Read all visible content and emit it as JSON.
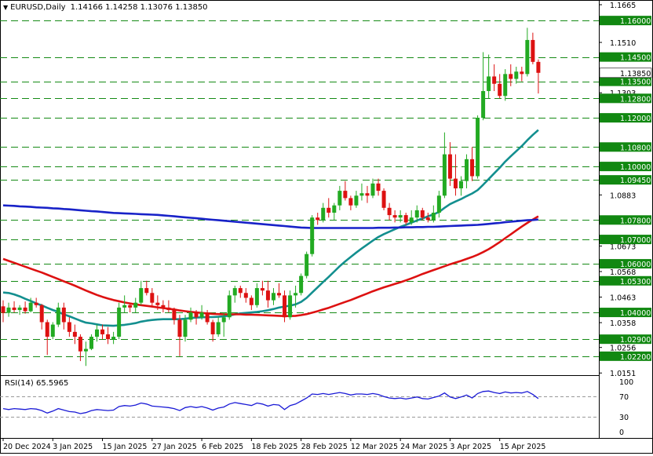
{
  "header": {
    "symbol": "EURUSD,Daily",
    "ohlc": "1.14166 1.14258 1.13076 1.13850"
  },
  "rsi_header": "RSI(14) 65.5965",
  "colors": {
    "up": "#22aa22",
    "down": "#dd1111",
    "ma_short": "#138f8f",
    "ma_mid": "#dd1111",
    "ma_long": "#1822c8",
    "level_line": "#158a15",
    "label_bg": "#118811",
    "rsi": "#1a1ad6",
    "rsi_level": "#999999"
  },
  "chart_data": [
    {
      "type": "candlestick",
      "title": "EURUSD,Daily",
      "ylim": [
        1.0155,
        1.1665
      ],
      "price_scale": [
        "1.1665",
        "1.1510",
        "1.1385",
        "1.1303",
        "1.0883",
        "1.0673",
        "1.0568",
        "1.0463",
        "1.0358",
        "1.0256",
        "1.0151"
      ],
      "levels": [
        {
          "value": 1.16,
          "label": "1.16000"
        },
        {
          "value": 1.145,
          "label": "1.14500"
        },
        {
          "value": 1.135,
          "label": "1.13500"
        },
        {
          "value": 1.128,
          "label": "1.12800"
        },
        {
          "value": 1.12,
          "label": "1.12000"
        },
        {
          "value": 1.108,
          "label": "1.10800"
        },
        {
          "value": 1.1,
          "label": "1.10000"
        },
        {
          "value": 1.0945,
          "label": "1.09450"
        },
        {
          "value": 1.078,
          "label": "1.07800"
        },
        {
          "value": 1.07,
          "label": "1.07000"
        },
        {
          "value": 1.06,
          "label": "1.06000"
        },
        {
          "value": 1.053,
          "label": "1.05300"
        },
        {
          "value": 1.04,
          "label": "1.04000"
        },
        {
          "value": 1.029,
          "label": "1.02900"
        },
        {
          "value": 1.022,
          "label": "1.02200"
        }
      ],
      "current_price": {
        "value": 1.1385,
        "label": "1.13850"
      },
      "x_labels": [
        "20 Dec 2024",
        "3 Jan 2025",
        "15 Jan 2025",
        "27 Jan 2025",
        "6 Feb 2025",
        "18 Feb 2025",
        "28 Feb 2025",
        "12 Mar 2025",
        "24 Mar 2025",
        "3 Apr 2025",
        "15 Apr 2025"
      ],
      "x_label_index": [
        0,
        9,
        18,
        27,
        36,
        45,
        54,
        63,
        72,
        81,
        90
      ],
      "candles": [
        [
          1.0425,
          1.045,
          1.036,
          1.0398
        ],
        [
          1.0398,
          1.044,
          1.0382,
          1.042
        ],
        [
          1.042,
          1.0446,
          1.04,
          1.041
        ],
        [
          1.041,
          1.043,
          1.039,
          1.042
        ],
        [
          1.042,
          1.0445,
          1.0395,
          1.0405
        ],
        [
          1.0405,
          1.046,
          1.04,
          1.044
        ],
        [
          1.044,
          1.046,
          1.042,
          1.043
        ],
        [
          1.043,
          1.0435,
          1.033,
          1.036
        ],
        [
          1.036,
          1.037,
          1.0225,
          1.03
        ],
        [
          1.03,
          1.036,
          1.029,
          1.035
        ],
        [
          1.035,
          1.044,
          1.034,
          1.042
        ],
        [
          1.042,
          1.044,
          1.033,
          1.036
        ],
        [
          1.036,
          1.038,
          1.03,
          1.032
        ],
        [
          1.032,
          1.035,
          1.027,
          1.03
        ],
        [
          1.03,
          1.031,
          1.02,
          1.024
        ],
        [
          1.024,
          1.028,
          1.018,
          1.025
        ],
        [
          1.025,
          1.031,
          1.0245,
          1.03
        ],
        [
          1.03,
          1.035,
          1.028,
          1.033
        ],
        [
          1.033,
          1.035,
          1.029,
          1.031
        ],
        [
          1.031,
          1.034,
          1.027,
          1.029
        ],
        [
          1.029,
          1.032,
          1.027,
          1.03
        ],
        [
          1.03,
          1.044,
          1.029,
          1.042
        ],
        [
          1.042,
          1.047,
          1.04,
          1.043
        ],
        [
          1.043,
          1.044,
          1.04,
          1.042
        ],
        [
          1.042,
          1.046,
          1.04,
          1.044
        ],
        [
          1.044,
          1.053,
          1.043,
          1.05
        ],
        [
          1.05,
          1.053,
          1.047,
          1.048
        ],
        [
          1.048,
          1.05,
          1.042,
          1.044
        ],
        [
          1.044,
          1.047,
          1.041,
          1.043
        ],
        [
          1.043,
          1.045,
          1.04,
          1.042
        ],
        [
          1.042,
          1.045,
          1.04,
          1.041
        ],
        [
          1.041,
          1.042,
          1.035,
          1.037
        ],
        [
          1.037,
          1.039,
          1.022,
          1.03
        ],
        [
          1.03,
          1.039,
          1.028,
          1.037
        ],
        [
          1.037,
          1.042,
          1.036,
          1.04
        ],
        [
          1.04,
          1.041,
          1.035,
          1.038
        ],
        [
          1.038,
          1.043,
          1.037,
          1.04
        ],
        [
          1.04,
          1.041,
          1.035,
          1.036
        ],
        [
          1.036,
          1.037,
          1.028,
          1.031
        ],
        [
          1.031,
          1.038,
          1.03,
          1.036
        ],
        [
          1.036,
          1.04,
          1.03,
          1.038
        ],
        [
          1.038,
          1.049,
          1.037,
          1.047
        ],
        [
          1.047,
          1.051,
          1.044,
          1.05
        ],
        [
          1.05,
          1.051,
          1.046,
          1.048
        ],
        [
          1.048,
          1.05,
          1.044,
          1.046
        ],
        [
          1.046,
          1.047,
          1.041,
          1.043
        ],
        [
          1.043,
          1.052,
          1.042,
          1.05
        ],
        [
          1.05,
          1.053,
          1.047,
          1.049
        ],
        [
          1.049,
          1.053,
          1.042,
          1.045
        ],
        [
          1.045,
          1.05,
          1.043,
          1.048
        ],
        [
          1.048,
          1.052,
          1.046,
          1.047
        ],
        [
          1.047,
          1.049,
          1.036,
          1.038
        ],
        [
          1.038,
          1.049,
          1.037,
          1.047
        ],
        [
          1.047,
          1.051,
          1.042,
          1.048
        ],
        [
          1.048,
          1.056,
          1.047,
          1.055
        ],
        [
          1.055,
          1.065,
          1.054,
          1.064
        ],
        [
          1.064,
          1.08,
          1.063,
          1.079
        ],
        [
          1.079,
          1.081,
          1.076,
          1.078
        ],
        [
          1.078,
          1.085,
          1.077,
          1.083
        ],
        [
          1.083,
          1.087,
          1.079,
          1.081
        ],
        [
          1.081,
          1.085,
          1.078,
          1.084
        ],
        [
          1.084,
          1.092,
          1.082,
          1.09
        ],
        [
          1.09,
          1.094,
          1.086,
          1.087
        ],
        [
          1.087,
          1.088,
          1.082,
          1.084
        ],
        [
          1.084,
          1.09,
          1.083,
          1.088
        ],
        [
          1.088,
          1.093,
          1.086,
          1.089
        ],
        [
          1.089,
          1.092,
          1.085,
          1.088
        ],
        [
          1.088,
          1.095,
          1.087,
          1.093
        ],
        [
          1.093,
          1.095,
          1.088,
          1.09
        ],
        [
          1.09,
          1.091,
          1.082,
          1.083
        ],
        [
          1.083,
          1.085,
          1.078,
          1.08
        ],
        [
          1.08,
          1.082,
          1.077,
          1.079
        ],
        [
          1.079,
          1.082,
          1.077,
          1.08
        ],
        [
          1.08,
          1.081,
          1.076,
          1.077
        ],
        [
          1.077,
          1.082,
          1.076,
          1.079
        ],
        [
          1.079,
          1.084,
          1.077,
          1.082
        ],
        [
          1.082,
          1.083,
          1.078,
          1.079
        ],
        [
          1.079,
          1.081,
          1.077,
          1.078
        ],
        [
          1.078,
          1.084,
          1.077,
          1.081
        ],
        [
          1.081,
          1.09,
          1.079,
          1.088
        ],
        [
          1.088,
          1.114,
          1.087,
          1.105
        ],
        [
          1.105,
          1.11,
          1.092,
          1.095
        ],
        [
          1.095,
          1.105,
          1.088,
          1.091
        ],
        [
          1.091,
          1.096,
          1.088,
          1.094
        ],
        [
          1.094,
          1.105,
          1.091,
          1.103
        ],
        [
          1.103,
          1.108,
          1.094,
          1.096
        ],
        [
          1.096,
          1.121,
          1.095,
          1.12
        ],
        [
          1.12,
          1.147,
          1.119,
          1.131
        ],
        [
          1.131,
          1.146,
          1.128,
          1.137
        ],
        [
          1.137,
          1.142,
          1.131,
          1.134
        ],
        [
          1.134,
          1.138,
          1.128,
          1.129
        ],
        [
          1.129,
          1.14,
          1.127,
          1.138
        ],
        [
          1.138,
          1.142,
          1.133,
          1.136
        ],
        [
          1.136,
          1.141,
          1.134,
          1.139
        ],
        [
          1.139,
          1.141,
          1.135,
          1.138
        ],
        [
          1.138,
          1.157,
          1.137,
          1.152
        ],
        [
          1.152,
          1.155,
          1.142,
          1.143
        ],
        [
          1.143,
          1.144,
          1.13,
          1.1385
        ]
      ],
      "moving_averages": [
        {
          "name": "ma_short",
          "color": "#138f8f",
          "start": 0,
          "values": [
            1.0482,
            1.048,
            1.0474,
            1.0466,
            1.0456,
            1.0447,
            1.0437,
            1.0429,
            1.0419,
            1.041,
            1.0402,
            1.0392,
            1.0384,
            1.0375,
            1.0366,
            1.0358,
            1.0355,
            1.0351,
            1.0347,
            1.0346,
            1.0345,
            1.0347,
            1.0349,
            1.0352,
            1.0356,
            1.0362,
            1.0366,
            1.0369,
            1.0371,
            1.0372,
            1.0372,
            1.0372,
            1.0372,
            1.0374,
            1.0377,
            1.0379,
            1.038,
            1.0381,
            1.0381,
            1.0382,
            1.0384,
            1.0387,
            1.0392,
            1.0396,
            1.0398,
            1.04,
            1.0402,
            1.0405,
            1.0409,
            1.0414,
            1.042,
            1.0424,
            1.0428,
            1.0433,
            1.0443,
            1.046,
            1.0482,
            1.0503,
            1.0525,
            1.0546,
            1.0568,
            1.059,
            1.061,
            1.0628,
            1.0646,
            1.0663,
            1.0679,
            1.0695,
            1.071,
            1.0722,
            1.0732,
            1.0742,
            1.0752,
            1.076,
            1.0769,
            1.0778,
            1.0786,
            1.0795,
            1.0803,
            1.0813,
            1.083,
            1.0845,
            1.0856,
            1.0866,
            1.0878,
            1.0889,
            1.0903,
            1.0925,
            1.0948,
            1.0972,
            1.0995,
            1.102,
            1.1042,
            1.1063,
            1.1084,
            1.1108,
            1.113,
            1.115
          ]
        },
        {
          "name": "ma_mid",
          "color": "#dd1111",
          "start": 0,
          "values": [
            1.062,
            1.0612,
            1.0604,
            1.0596,
            1.0588,
            1.058,
            1.0572,
            1.0564,
            1.0555,
            1.0546,
            1.0537,
            1.0528,
            1.0519,
            1.051,
            1.05,
            1.049,
            1.0481,
            1.0472,
            1.0464,
            1.0457,
            1.0451,
            1.0446,
            1.0441,
            1.0437,
            1.0433,
            1.043,
            1.0427,
            1.0424,
            1.0421,
            1.0418,
            1.0415,
            1.0412,
            1.0408,
            1.0405,
            1.0402,
            1.04,
            1.0398,
            1.0396,
            1.0394,
            1.0393,
            1.0392,
            1.0392,
            1.0392,
            1.0392,
            1.0391,
            1.0391,
            1.039,
            1.0389,
            1.0388,
            1.0387,
            1.0386,
            1.0385,
            1.0385,
            1.0386,
            1.0389,
            1.0393,
            1.0399,
            1.0405,
            1.0412,
            1.0419,
            1.0427,
            1.0435,
            1.0443,
            1.0451,
            1.046,
            1.0469,
            1.0478,
            1.0487,
            1.0495,
            1.0503,
            1.051,
            1.0517,
            1.0524,
            1.0532,
            1.054,
            1.0549,
            1.0558,
            1.0566,
            1.0574,
            1.0582,
            1.059,
            1.0598,
            1.0605,
            1.0612,
            1.062,
            1.0628,
            1.0637,
            1.0648,
            1.066,
            1.0674,
            1.0689,
            1.0705,
            1.0721,
            1.0737,
            1.0753,
            1.0768,
            1.0782,
            1.0795
          ]
        },
        {
          "name": "ma_long",
          "color": "#1822c8",
          "start": 0,
          "values": [
            1.084,
            1.0839,
            1.0838,
            1.0836,
            1.0835,
            1.0834,
            1.0832,
            1.0831,
            1.083,
            1.0828,
            1.0827,
            1.0825,
            1.0824,
            1.0822,
            1.082,
            1.0818,
            1.0816,
            1.0815,
            1.0813,
            1.0811,
            1.0809,
            1.0808,
            1.0807,
            1.0806,
            1.0805,
            1.0804,
            1.0803,
            1.0802,
            1.0801,
            1.0799,
            1.0797,
            1.0795,
            1.0793,
            1.0791,
            1.0789,
            1.0787,
            1.0785,
            1.0783,
            1.0781,
            1.0779,
            1.0777,
            1.0775,
            1.0773,
            1.0771,
            1.0769,
            1.0767,
            1.0765,
            1.0763,
            1.0761,
            1.0759,
            1.0757,
            1.0755,
            1.0753,
            1.0751,
            1.0749,
            1.0748,
            1.0747,
            1.0747,
            1.0747,
            1.0747,
            1.0747,
            1.0747,
            1.0747,
            1.0747,
            1.0747,
            1.0747,
            1.0747,
            1.0747,
            1.0748,
            1.0748,
            1.0748,
            1.0749,
            1.0749,
            1.075,
            1.075,
            1.0751,
            1.0751,
            1.0752,
            1.0752,
            1.0753,
            1.0754,
            1.0755,
            1.0756,
            1.0757,
            1.0758,
            1.0759,
            1.076,
            1.0762,
            1.0764,
            1.0766,
            1.0768,
            1.0771,
            1.0773,
            1.0775,
            1.0777,
            1.0779,
            1.078,
            1.0782
          ]
        }
      ]
    },
    {
      "type": "line",
      "title": "RSI(14) 65.5965",
      "ylim": [
        0,
        100
      ],
      "levels": [
        30,
        70
      ],
      "ticks": [
        "100",
        "70",
        "30",
        "0"
      ],
      "series": [
        {
          "name": "RSI(14)",
          "values": [
            46,
            44,
            46,
            45,
            44,
            46,
            45,
            42,
            37,
            41,
            46,
            43,
            40,
            39,
            36,
            38,
            42,
            44,
            43,
            42,
            43,
            50,
            52,
            51,
            53,
            57,
            55,
            51,
            50,
            49,
            48,
            46,
            42,
            48,
            50,
            48,
            50,
            47,
            43,
            47,
            49,
            55,
            58,
            56,
            54,
            52,
            57,
            55,
            51,
            54,
            53,
            44,
            52,
            55,
            61,
            67,
            75,
            74,
            76,
            74,
            76,
            78,
            76,
            73,
            75,
            75,
            74,
            76,
            74,
            70,
            67,
            66,
            67,
            65,
            67,
            69,
            66,
            65,
            68,
            71,
            77,
            69,
            66,
            69,
            73,
            67,
            76,
            80,
            81,
            78,
            76,
            79,
            77,
            78,
            77,
            80,
            74,
            66
          ]
        }
      ]
    }
  ]
}
